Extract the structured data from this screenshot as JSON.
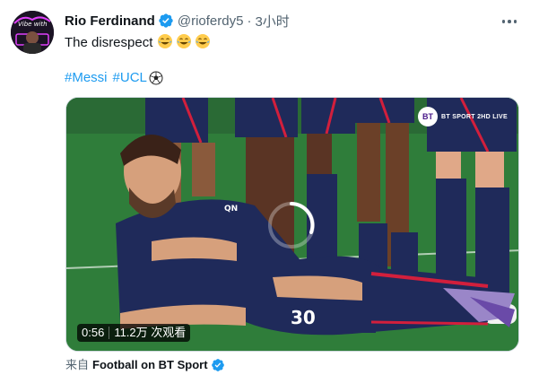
{
  "tweet": {
    "author_name": "Rio Ferdinand",
    "handle": "@rioferdy5",
    "separator": "·",
    "time": "3小时",
    "text": "The disrespect",
    "emojis": [
      "tears-of-joy",
      "tears-of-joy",
      "tears-of-joy"
    ],
    "hashtags": [
      "#Messi",
      "#UCL"
    ],
    "hashtag_suffix_icon": "soccer-ball-icon"
  },
  "media": {
    "duration": "0:56",
    "views": "11.2万 次观看",
    "channel_logo_text": "BT",
    "channel_label": "BT SPORT 2HD LIVE",
    "jersey_number": "30",
    "sponsor_text": "QN"
  },
  "source": {
    "prefix": "来自",
    "account": "Football on BT Sport"
  },
  "colors": {
    "link": "#1d9bf0",
    "secondary_text": "#536471",
    "verified": "#1d9bf0",
    "pitch": "#2d7a3a",
    "kit": "#1f2a5a"
  }
}
